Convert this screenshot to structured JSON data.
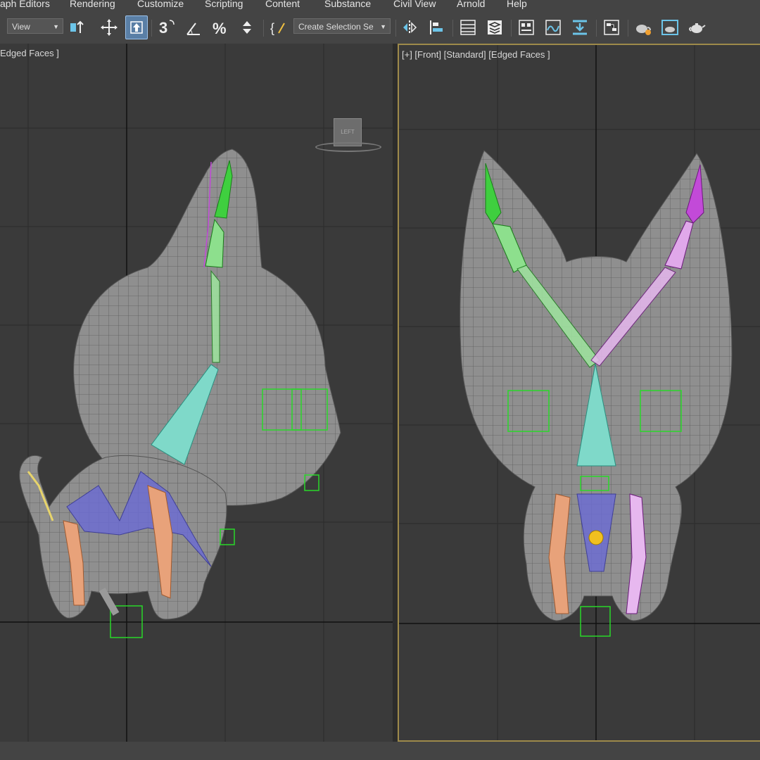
{
  "menu": {
    "items": [
      "aph Editors",
      "Rendering",
      "Customize",
      "Scripting",
      "Content",
      "Substance",
      "Civil View",
      "Arnold",
      "Help"
    ]
  },
  "toolbar": {
    "ref_coord": "View",
    "selection_set": "Create Selection Se"
  },
  "viewports": {
    "left": {
      "label": "Edged Faces ]",
      "viewcube_label": "LEFT"
    },
    "right": {
      "label": "[+] [Front] [Standard] [Edged Faces ]"
    }
  },
  "colors": {
    "accent": "#9cc3ec",
    "active_viewport_border": "#9e8a4a",
    "mesh": "#8f8f8f",
    "bone_green": "#3fcf3f",
    "bone_magenta": "#c24ad8",
    "bone_cyan": "#7fd9c9",
    "bone_orange": "#e8a27a",
    "bone_blue": "#6b6bd6",
    "helper_green": "#29d829"
  },
  "icons": [
    "select-move-icon",
    "select-object-icon",
    "snap-3d-icon",
    "angle-snap-icon",
    "percent-snap-icon",
    "spinner-snap-icon",
    "named-selection-icon",
    "mirror-icon",
    "align-icon",
    "scene-explorer-icon",
    "layer-icon",
    "ribbon-icon",
    "curve-editor-icon",
    "schematic-icon",
    "material-editor-icon",
    "render-setup-icon",
    "render-frame-icon",
    "render-teapot-icon"
  ]
}
